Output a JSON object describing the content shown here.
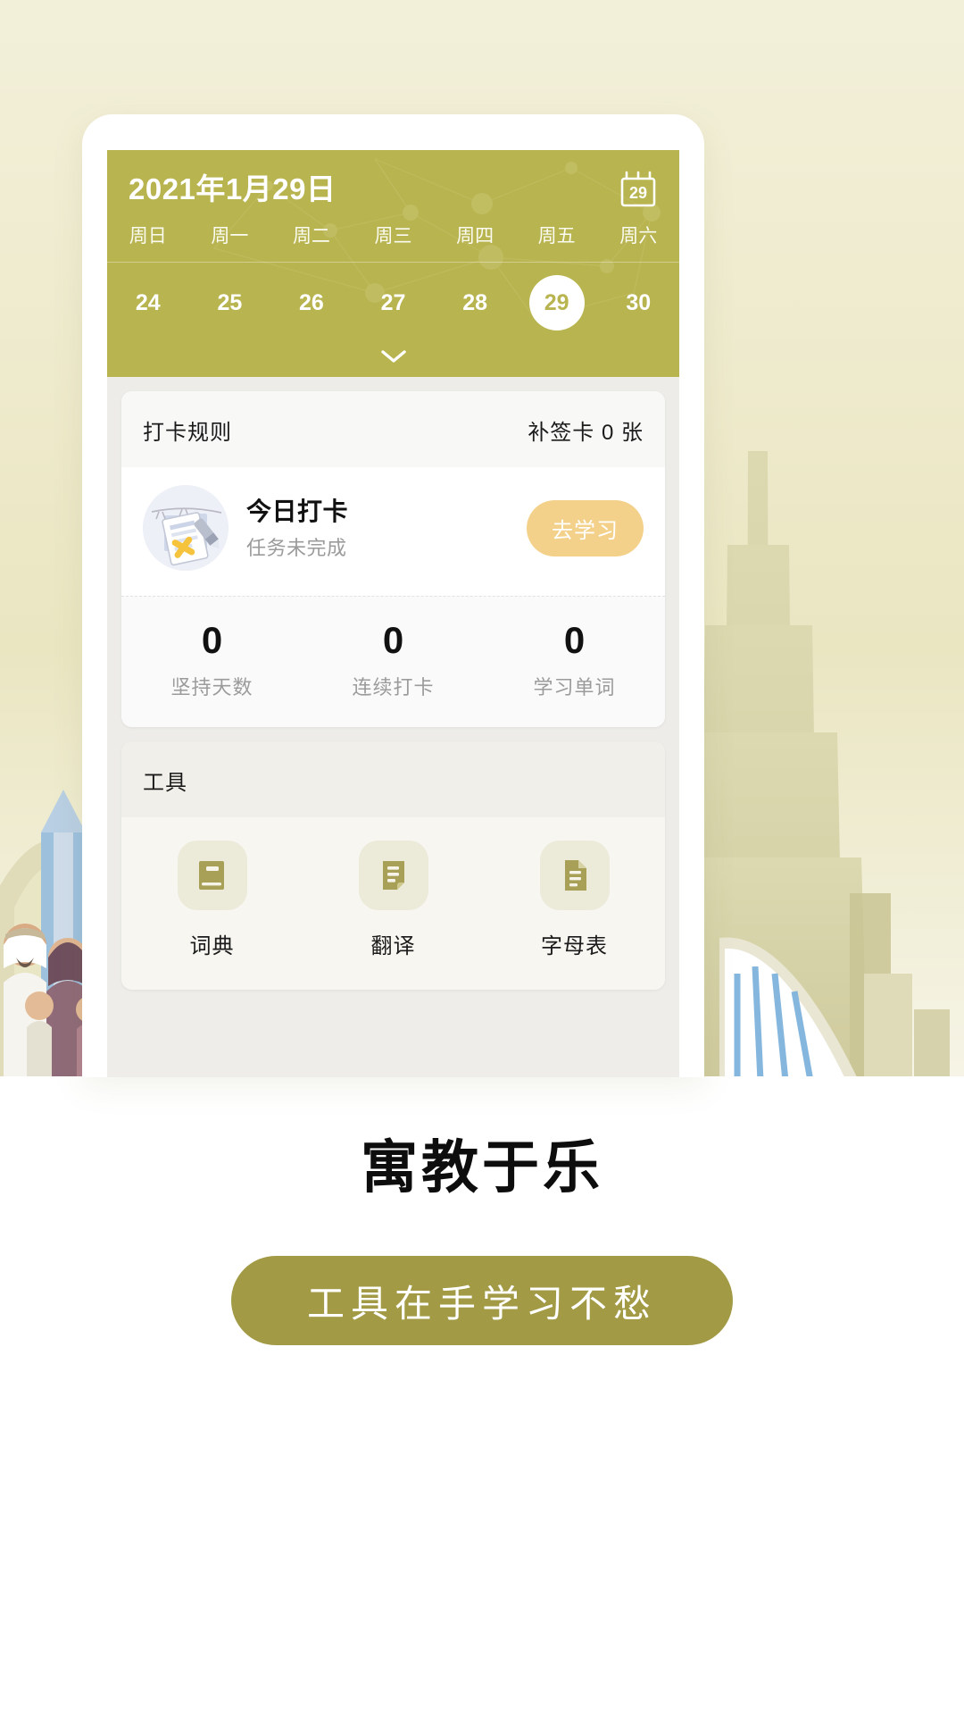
{
  "app": {
    "header": {
      "date_title": "2021年1月29日",
      "calendar_icon_day": "29",
      "weekdays": [
        "周日",
        "周一",
        "周二",
        "周三",
        "周四",
        "周五",
        "周六"
      ],
      "dates": [
        {
          "day": "24",
          "selected": false
        },
        {
          "day": "25",
          "selected": false
        },
        {
          "day": "26",
          "selected": false
        },
        {
          "day": "27",
          "selected": false
        },
        {
          "day": "28",
          "selected": false
        },
        {
          "day": "29",
          "selected": true
        },
        {
          "day": "30",
          "selected": false
        }
      ],
      "accent_color": "#b8b450"
    },
    "checkin_card": {
      "rules_label": "打卡规则",
      "makeup_label": "补签卡 0 张",
      "today_title": "今日打卡",
      "today_status": "任务未完成",
      "action_label": "去学习",
      "action_color": "#f4d18b",
      "stats": [
        {
          "value": "0",
          "label": "坚持天数"
        },
        {
          "value": "0",
          "label": "连续打卡"
        },
        {
          "value": "0",
          "label": "学习单词"
        }
      ]
    },
    "tools_card": {
      "title": "工具",
      "items": [
        {
          "label": "词典",
          "icon": "book-icon"
        },
        {
          "label": "翻译",
          "icon": "document-fold-icon"
        },
        {
          "label": "字母表",
          "icon": "file-text-icon"
        }
      ],
      "icon_color": "#a8a057"
    }
  },
  "promo": {
    "headline": "寓教于乐",
    "cta_label": "工具在手学习不愁",
    "cta_color": "#a29a45"
  }
}
